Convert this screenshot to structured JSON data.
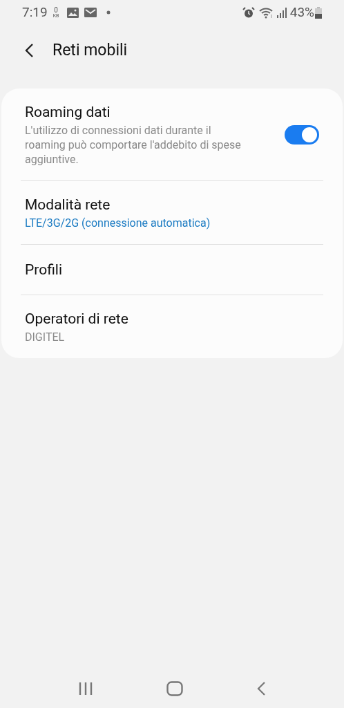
{
  "status_bar": {
    "time": "7:19",
    "data_rate": "0",
    "data_unit": "KB",
    "battery": "43%"
  },
  "header": {
    "title": "Reti mobili"
  },
  "items": [
    {
      "title": "Roaming dati",
      "subtitle": "L'utilizzo di connessioni dati durante il roaming può comportare l'addebito di spese aggiuntive.",
      "subtitle_accent": false,
      "kind": "toggle",
      "on": true
    },
    {
      "title": "Modalità rete",
      "subtitle": "LTE/3G/2G (connessione automatica)",
      "subtitle_accent": true,
      "kind": "plain"
    },
    {
      "title": "Profili",
      "kind": "plain"
    },
    {
      "title": "Operatori di rete",
      "subtitle": "DIGITEL",
      "subtitle_accent": false,
      "kind": "plain"
    }
  ]
}
